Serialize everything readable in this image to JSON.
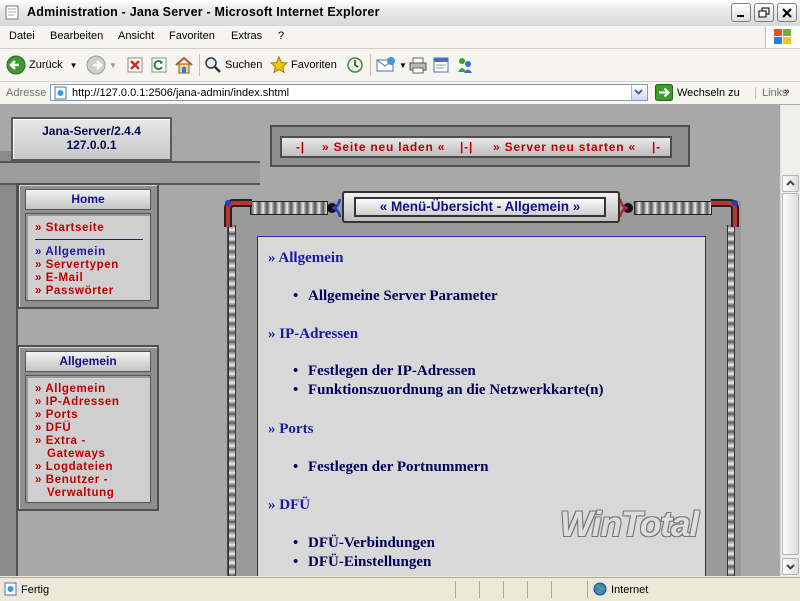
{
  "window": {
    "title": "Administration - Jana Server - Microsoft Internet Explorer"
  },
  "menubar": [
    "Datei",
    "Bearbeiten",
    "Ansicht",
    "Favoriten",
    "Extras",
    "?"
  ],
  "toolbar": {
    "back": "Zurück",
    "search": "Suchen",
    "favorites": "Favoriten"
  },
  "address": {
    "label": "Adresse",
    "url": "http://127.0.0.1:2506/jana-admin/index.shtml",
    "go": "Wechseln zu",
    "links": "Links"
  },
  "server": {
    "name": "Jana-Server/2.4.4",
    "ip": "127.0.0.1"
  },
  "topbar": {
    "sep1": "-|",
    "reload": "» Seite neu laden «",
    "sep2": "|-|",
    "restart": "» Server neu starten «",
    "sep3": "|-"
  },
  "home_panel": {
    "title": "Home",
    "items": [
      "» Startseite",
      "» Allgemein",
      "» Servertypen",
      "» E-Mail",
      "» Passwörter"
    ]
  },
  "general_panel": {
    "title": "Allgemein",
    "items": [
      "» Allgemein",
      "» IP-Adressen",
      "» Ports",
      "» DFÜ",
      "» Extra -",
      "Gateways",
      "» Logdateien",
      "» Benutzer -",
      "Verwaltung"
    ]
  },
  "main": {
    "title": "« Menü-Übersicht - Allgemein »",
    "sections": [
      {
        "head": "» Allgemein",
        "items": [
          "Allgemeine Server Parameter"
        ]
      },
      {
        "head": "» IP-Adressen",
        "items": [
          "Festlegen der IP-Adressen",
          "Funktionszuordnung an die Netzwerkkarte(n)"
        ]
      },
      {
        "head": "» Ports",
        "items": [
          "Festlegen der Portnummern"
        ]
      },
      {
        "head": "» DFÜ",
        "items": [
          "DFÜ-Verbindungen",
          "DFÜ-Einstellungen"
        ]
      }
    ]
  },
  "watermark": "WinTotal",
  "status": {
    "text": "Fertig",
    "zone": "Internet"
  },
  "colors": {
    "nav_red": "#c00000",
    "nav_blue": "#1a1aa0",
    "frame_gray": "#a8a8a8"
  }
}
